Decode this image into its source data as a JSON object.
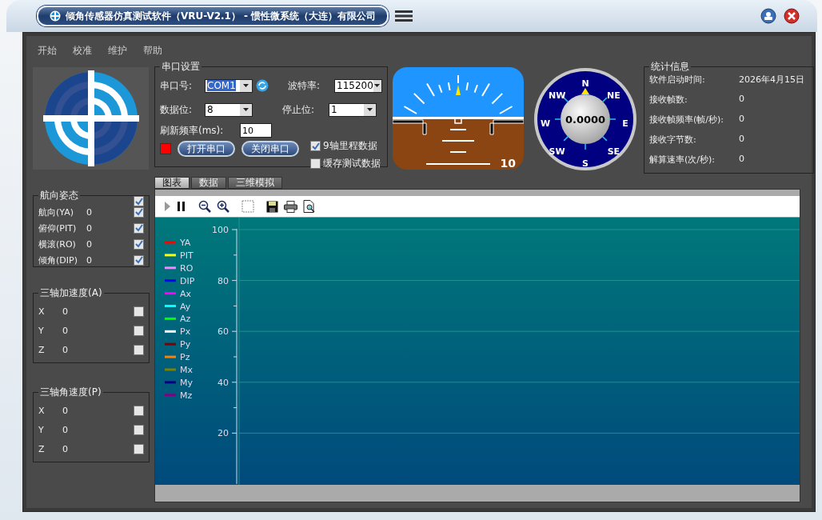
{
  "window": {
    "title": "倾角传感器仿真测试软件（VRU-V2.1） - 惯性微系统（大连）有限公司"
  },
  "menu": [
    "开始",
    "校准",
    "维护",
    "帮助"
  ],
  "groups": [
    {
      "title": "航向姿态",
      "checked": true,
      "items": [
        {
          "label": "航向(YA)",
          "value": "0",
          "checked": true
        },
        {
          "label": "俯仰(PIT)",
          "value": "0",
          "checked": true
        },
        {
          "label": "横滚(RO)",
          "value": "0",
          "checked": true
        },
        {
          "label": "倾角(DIP)",
          "value": "0",
          "checked": true
        }
      ]
    },
    {
      "title": "三轴加速度(A)",
      "items": [
        {
          "label": "X",
          "value": "0",
          "checked": false
        },
        {
          "label": "Y",
          "value": "0",
          "checked": false
        },
        {
          "label": "Z",
          "value": "0",
          "checked": false
        }
      ]
    },
    {
      "title": "三轴角速度(P)",
      "items": [
        {
          "label": "X",
          "value": "0",
          "checked": false
        },
        {
          "label": "Y",
          "value": "0",
          "checked": false
        },
        {
          "label": "Z",
          "value": "0",
          "checked": false
        }
      ]
    }
  ],
  "serial": {
    "title": "串口设置",
    "port_label": "串口号:",
    "port": "COM1",
    "baud_label": "波特率:",
    "baud": "115200",
    "databits_label": "数据位:",
    "databits": "8",
    "stopbits_label": "停止位:",
    "stopbits": "1",
    "refresh_label": "刷新频率(ms):",
    "refresh": "10",
    "port_open": false,
    "open_button": "打开串口",
    "close_button": "关闭串口",
    "options": [
      {
        "label": "9轴里程数据",
        "checked": true
      },
      {
        "label": "缓存测试数据",
        "checked": false
      }
    ]
  },
  "attitude_indicator": {
    "reading": "10"
  },
  "compass": {
    "value": "0.0000",
    "directions": [
      "N",
      "NE",
      "E",
      "SE",
      "S",
      "SW",
      "W",
      "NW"
    ]
  },
  "stats": {
    "title": "统计信息",
    "rows": [
      {
        "label": "软件启动时间:",
        "value": "2026年4月15日"
      },
      {
        "label": "接收帧数:",
        "value": "0"
      },
      {
        "label": "接收帧频率(帧/秒):",
        "value": "0"
      },
      {
        "label": "接收字节数:",
        "value": "0"
      },
      {
        "label": "解算速率(次/秒):",
        "value": "0"
      }
    ]
  },
  "tabs": [
    {
      "label": "图表",
      "selected": true
    },
    {
      "label": "数据",
      "selected": false
    },
    {
      "label": "三维模拟",
      "selected": false
    }
  ],
  "chart": {
    "chart_data": {
      "type": "line",
      "grid": true,
      "ylim": [
        0,
        100
      ],
      "yticks": [
        20,
        40,
        60,
        80,
        100
      ],
      "series": [
        {
          "name": "YA",
          "color": "#ff0000"
        },
        {
          "name": "PIT",
          "color": "#ffff00"
        },
        {
          "name": "RO",
          "color": "#ff80ff"
        },
        {
          "name": "DIP",
          "color": "#0000ff"
        },
        {
          "name": "Ax",
          "color": "#ff00ff"
        },
        {
          "name": "Ay",
          "color": "#00ffff"
        },
        {
          "name": "Az",
          "color": "#00ff00"
        },
        {
          "name": "Px",
          "color": "#ffffff"
        },
        {
          "name": "Py",
          "color": "#800000"
        },
        {
          "name": "Pz",
          "color": "#ff8000"
        },
        {
          "name": "Mx",
          "color": "#808000"
        },
        {
          "name": "My",
          "color": "#000080"
        },
        {
          "name": "Mz",
          "color": "#800080"
        }
      ]
    }
  }
}
